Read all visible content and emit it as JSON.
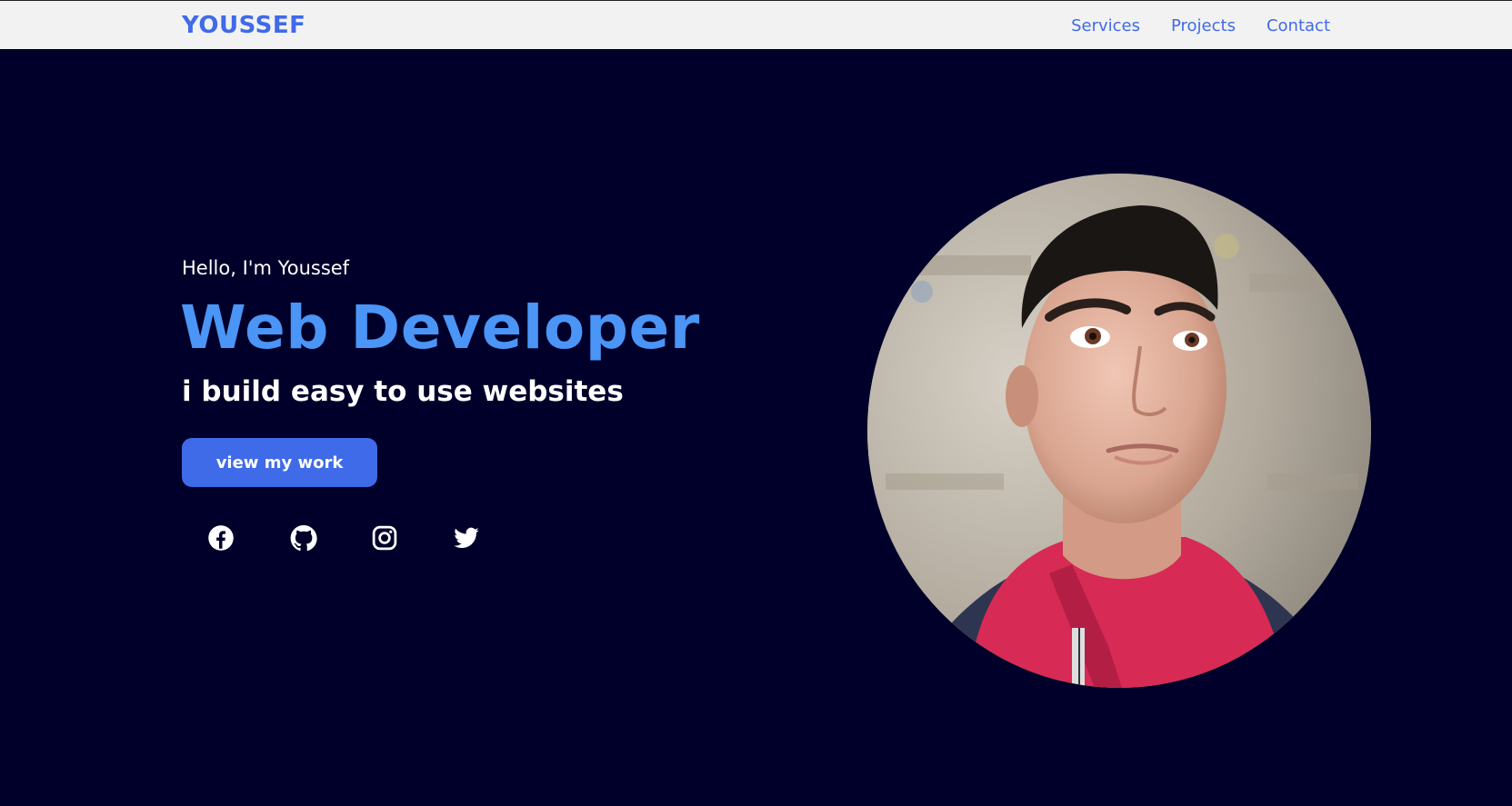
{
  "nav": {
    "logo": "YOUSSEF",
    "links": [
      "Services",
      "Projects",
      "Contact"
    ]
  },
  "hero": {
    "greeting": "Hello, I'm Youssef",
    "title": "Web Developer",
    "subtitle": "i build easy to use websites",
    "cta_label": "view my work"
  },
  "social": {
    "icons": [
      "facebook-icon",
      "github-icon",
      "instagram-icon",
      "twitter-icon"
    ]
  },
  "colors": {
    "background": "#00002a",
    "navbar": "#f2f2f2",
    "accent": "#3f6ae8",
    "title": "#4a95f6",
    "text": "#ffffff"
  }
}
